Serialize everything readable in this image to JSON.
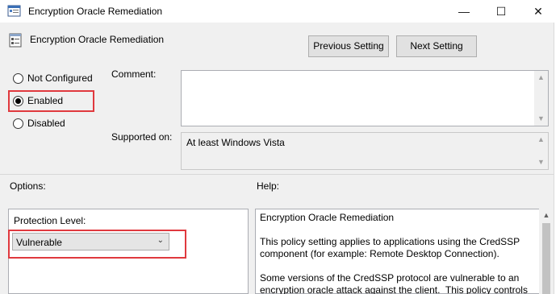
{
  "window": {
    "title": "Encryption Oracle Remediation",
    "minimize_label": "—",
    "maximize_label": "☐",
    "close_label": "✕"
  },
  "header": {
    "policy_title": "Encryption Oracle Remediation",
    "prev_button": "Previous Setting",
    "next_button": "Next Setting"
  },
  "state": {
    "options": [
      {
        "label": "Not Configured",
        "checked": false
      },
      {
        "label": "Enabled",
        "checked": true
      },
      {
        "label": "Disabled",
        "checked": false
      }
    ]
  },
  "comment": {
    "label": "Comment:",
    "value": ""
  },
  "supported": {
    "label": "Supported on:",
    "value": "At least Windows Vista"
  },
  "options_section": {
    "label": "Options:",
    "protection_label": "Protection Level:",
    "protection_value": "Vulnerable"
  },
  "help_section": {
    "label": "Help:",
    "text": "Encryption Oracle Remediation\n\nThis policy setting applies to applications using the CredSSP component (for example: Remote Desktop Connection).\n\nSome versions of the CredSSP protocol are vulnerable to an encryption oracle attack against the client.  This policy controls"
  },
  "icons": {
    "title_icon": "policy-window-icon",
    "header_icon": "policy-setting-icon",
    "scroll_up": "▲",
    "scroll_down": "▼",
    "dropdown_arrow": "⌄"
  },
  "colors": {
    "highlight": "#e0393e",
    "window_bg": "#f0f0f0"
  }
}
